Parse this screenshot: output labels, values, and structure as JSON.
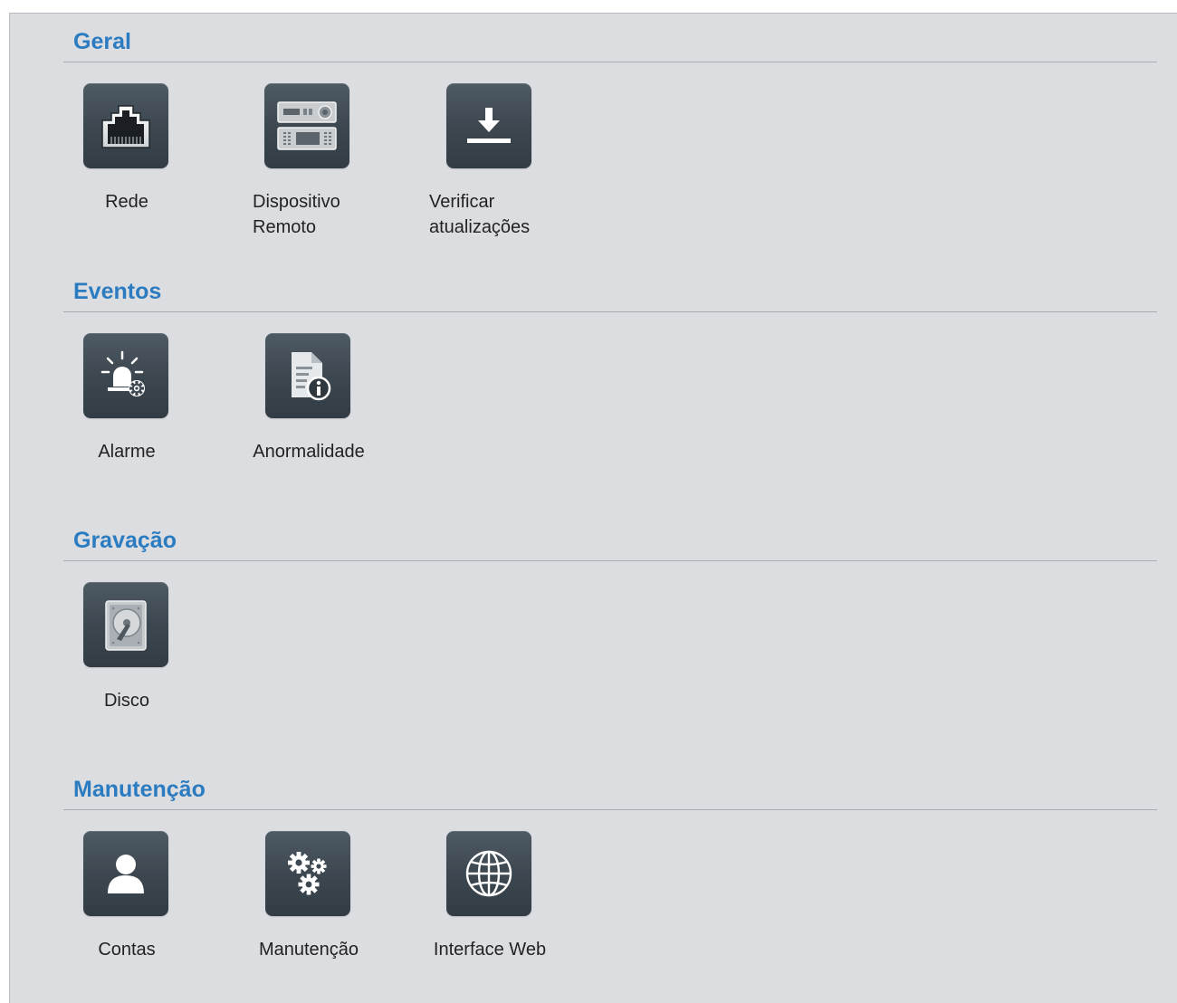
{
  "sections": [
    {
      "title": "Geral",
      "items": [
        {
          "label": "Rede",
          "icon": "ethernet-port-icon"
        },
        {
          "label_line1": "Dispositivo",
          "label_line2": "Remoto",
          "icon": "remote-device-icon"
        },
        {
          "label_line1": "Verificar",
          "label_line2": "atualizações",
          "icon": "download-update-icon"
        }
      ]
    },
    {
      "title": "Eventos",
      "items": [
        {
          "label": "Alarme",
          "icon": "alarm-siren-icon"
        },
        {
          "label": "Anormalidade",
          "icon": "document-info-icon"
        }
      ]
    },
    {
      "title": "Gravação",
      "items": [
        {
          "label": "Disco",
          "icon": "hard-disk-icon"
        }
      ]
    },
    {
      "title": "Manutenção",
      "items": [
        {
          "label": "Contas",
          "icon": "user-account-icon"
        },
        {
          "label": "Manutenção",
          "icon": "gears-icon"
        },
        {
          "label": "Interface Web",
          "icon": "globe-icon"
        }
      ]
    }
  ],
  "colors": {
    "section_title": "#2b7bc0",
    "panel_background": "#dcdde1",
    "tile_background": "#3d4750",
    "label_text": "#222222"
  }
}
